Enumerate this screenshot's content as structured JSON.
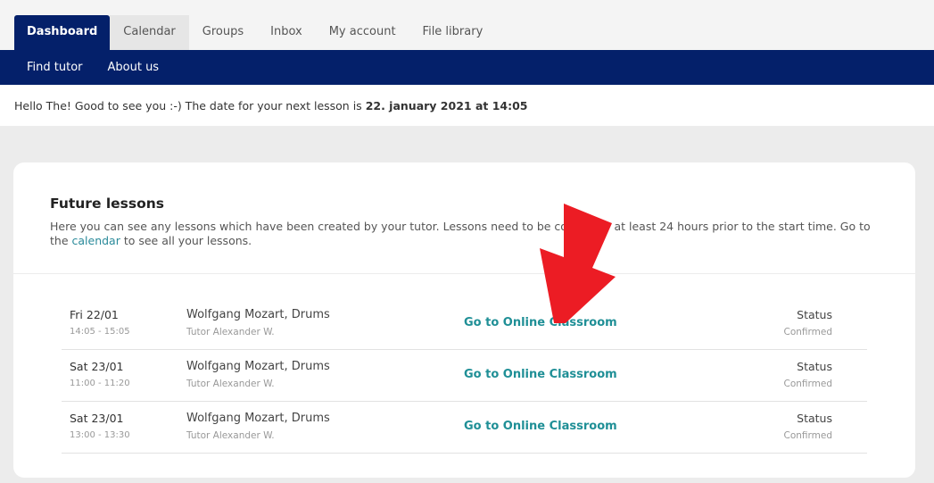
{
  "top_tabs": [
    {
      "label": "Dashboard"
    },
    {
      "label": "Calendar"
    },
    {
      "label": "Groups"
    },
    {
      "label": "Inbox"
    },
    {
      "label": "My account"
    },
    {
      "label": "File library"
    }
  ],
  "sub_nav": [
    {
      "label": "Find tutor"
    },
    {
      "label": "About us"
    }
  ],
  "greeting": {
    "text": "Hello The! Good to see you :-) The date for your next lesson is",
    "next_lesson": "22. january 2021 at 14:05"
  },
  "future_lessons": {
    "title": "Future lessons",
    "desc_before": "Here you can see any lessons which have been created by your tutor. Lessons need to be co",
    "desc_hidden": "nfirmed",
    "desc_after_arrow": "at least 24 hours prior to the start time. Go to the ",
    "calendar_link": "calendar",
    "desc_end": " to see all your lessons."
  },
  "lessons": [
    {
      "date": "Fri 22/01",
      "time": "14:05 - 15:05",
      "course": "Wolfgang Mozart, Drums",
      "tutor": "Tutor Alexander W.",
      "action": "Go to Online Classroom",
      "status_label": "Status",
      "status": "Confirmed"
    },
    {
      "date": "Sat 23/01",
      "time": "11:00 - 11:20",
      "course": "Wolfgang Mozart, Drums",
      "tutor": "Tutor Alexander W.",
      "action": "Go to Online Classroom",
      "status_label": "Status",
      "status": "Confirmed"
    },
    {
      "date": "Sat 23/01",
      "time": "13:00 - 13:30",
      "course": "Wolfgang Mozart, Drums",
      "tutor": "Tutor Alexander W.",
      "action": "Go to Online Classroom",
      "status_label": "Status",
      "status": "Confirmed"
    }
  ],
  "colors": {
    "nav_blue": "#04206a",
    "accent_teal": "#1f8f96",
    "arrow_red": "#ec1c24"
  },
  "icons": {
    "annotation": "red-arrow-icon"
  }
}
